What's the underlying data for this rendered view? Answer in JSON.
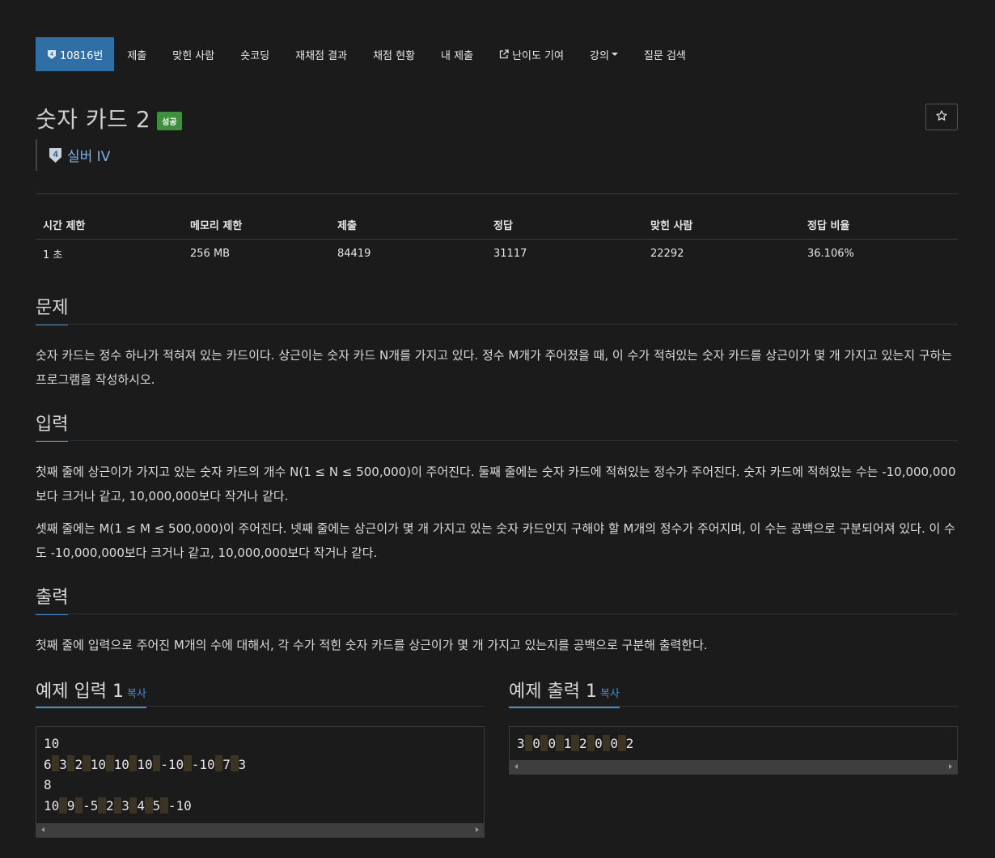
{
  "nav": {
    "items": [
      {
        "label": "10816번",
        "active": true,
        "icon": "tier-icon"
      },
      {
        "label": "제출"
      },
      {
        "label": "맞힌 사람"
      },
      {
        "label": "숏코딩"
      },
      {
        "label": "재채점 결과"
      },
      {
        "label": "채점 현황"
      },
      {
        "label": "내 제출"
      },
      {
        "label": "난이도 기여",
        "icon": "external-link-icon"
      },
      {
        "label": "강의",
        "dropdown": true
      },
      {
        "label": "질문 검색"
      }
    ]
  },
  "problem": {
    "title": "숫자 카드 2",
    "status_badge": "성공",
    "tier_label": "실버 IV",
    "tier_number": "4"
  },
  "info_table": {
    "headers": [
      "시간 제한",
      "메모리 제한",
      "제출",
      "정답",
      "맞힌 사람",
      "정답 비율"
    ],
    "values": [
      "1 초",
      "256 MB",
      "84419",
      "31117",
      "22292",
      "36.106%"
    ]
  },
  "sections": {
    "problem_heading": "문제",
    "problem_text": "숫자 카드는 정수 하나가 적혀져 있는 카드이다. 상근이는 숫자 카드 N개를 가지고 있다. 정수 M개가 주어졌을 때, 이 수가 적혀있는 숫자 카드를 상근이가 몇 개 가지고 있는지 구하는 프로그램을 작성하시오.",
    "input_heading": "입력",
    "input_text_1": "첫째 줄에 상근이가 가지고 있는 숫자 카드의 개수 N(1 ≤ N ≤ 500,000)이 주어진다. 둘째 줄에는 숫자 카드에 적혀있는 정수가 주어진다. 숫자 카드에 적혀있는 수는 -10,000,000보다 크거나 같고, 10,000,000보다 작거나 같다.",
    "input_text_2": "셋째 줄에는 M(1 ≤ M ≤ 500,000)이 주어진다. 넷째 줄에는 상근이가 몇 개 가지고 있는 숫자 카드인지 구해야 할 M개의 정수가 주어지며, 이 수는 공백으로 구분되어져 있다. 이 수도 -10,000,000보다 크거나 같고, 10,000,000보다 작거나 같다.",
    "output_heading": "출력",
    "output_text": "첫째 줄에 입력으로 주어진 M개의 수에 대해서, 각 수가 적힌 숫자 카드를 상근이가 몇 개 가지고 있는지를 공백으로 구분해 출력한다."
  },
  "samples": {
    "input_heading": "예제 입력 1",
    "output_heading": "예제 출력 1",
    "copy_label": "복사",
    "input_lines": [
      [
        "10"
      ],
      [
        "6",
        "3",
        "2",
        "10",
        "10",
        "10",
        "-10",
        "-10",
        "7",
        "3"
      ],
      [
        "8"
      ],
      [
        "10",
        "9",
        "-5",
        "2",
        "3",
        "4",
        "5",
        "-10"
      ]
    ],
    "output_lines": [
      [
        "3",
        "0",
        "0",
        "1",
        "2",
        "0",
        "0",
        "2"
      ]
    ]
  },
  "colors": {
    "background": "#1b1b1b",
    "nav_active": "#2f6fa5",
    "success": "#3f8f3f",
    "link": "#3f8fd6",
    "tier_silver": "#7fb2e6"
  }
}
